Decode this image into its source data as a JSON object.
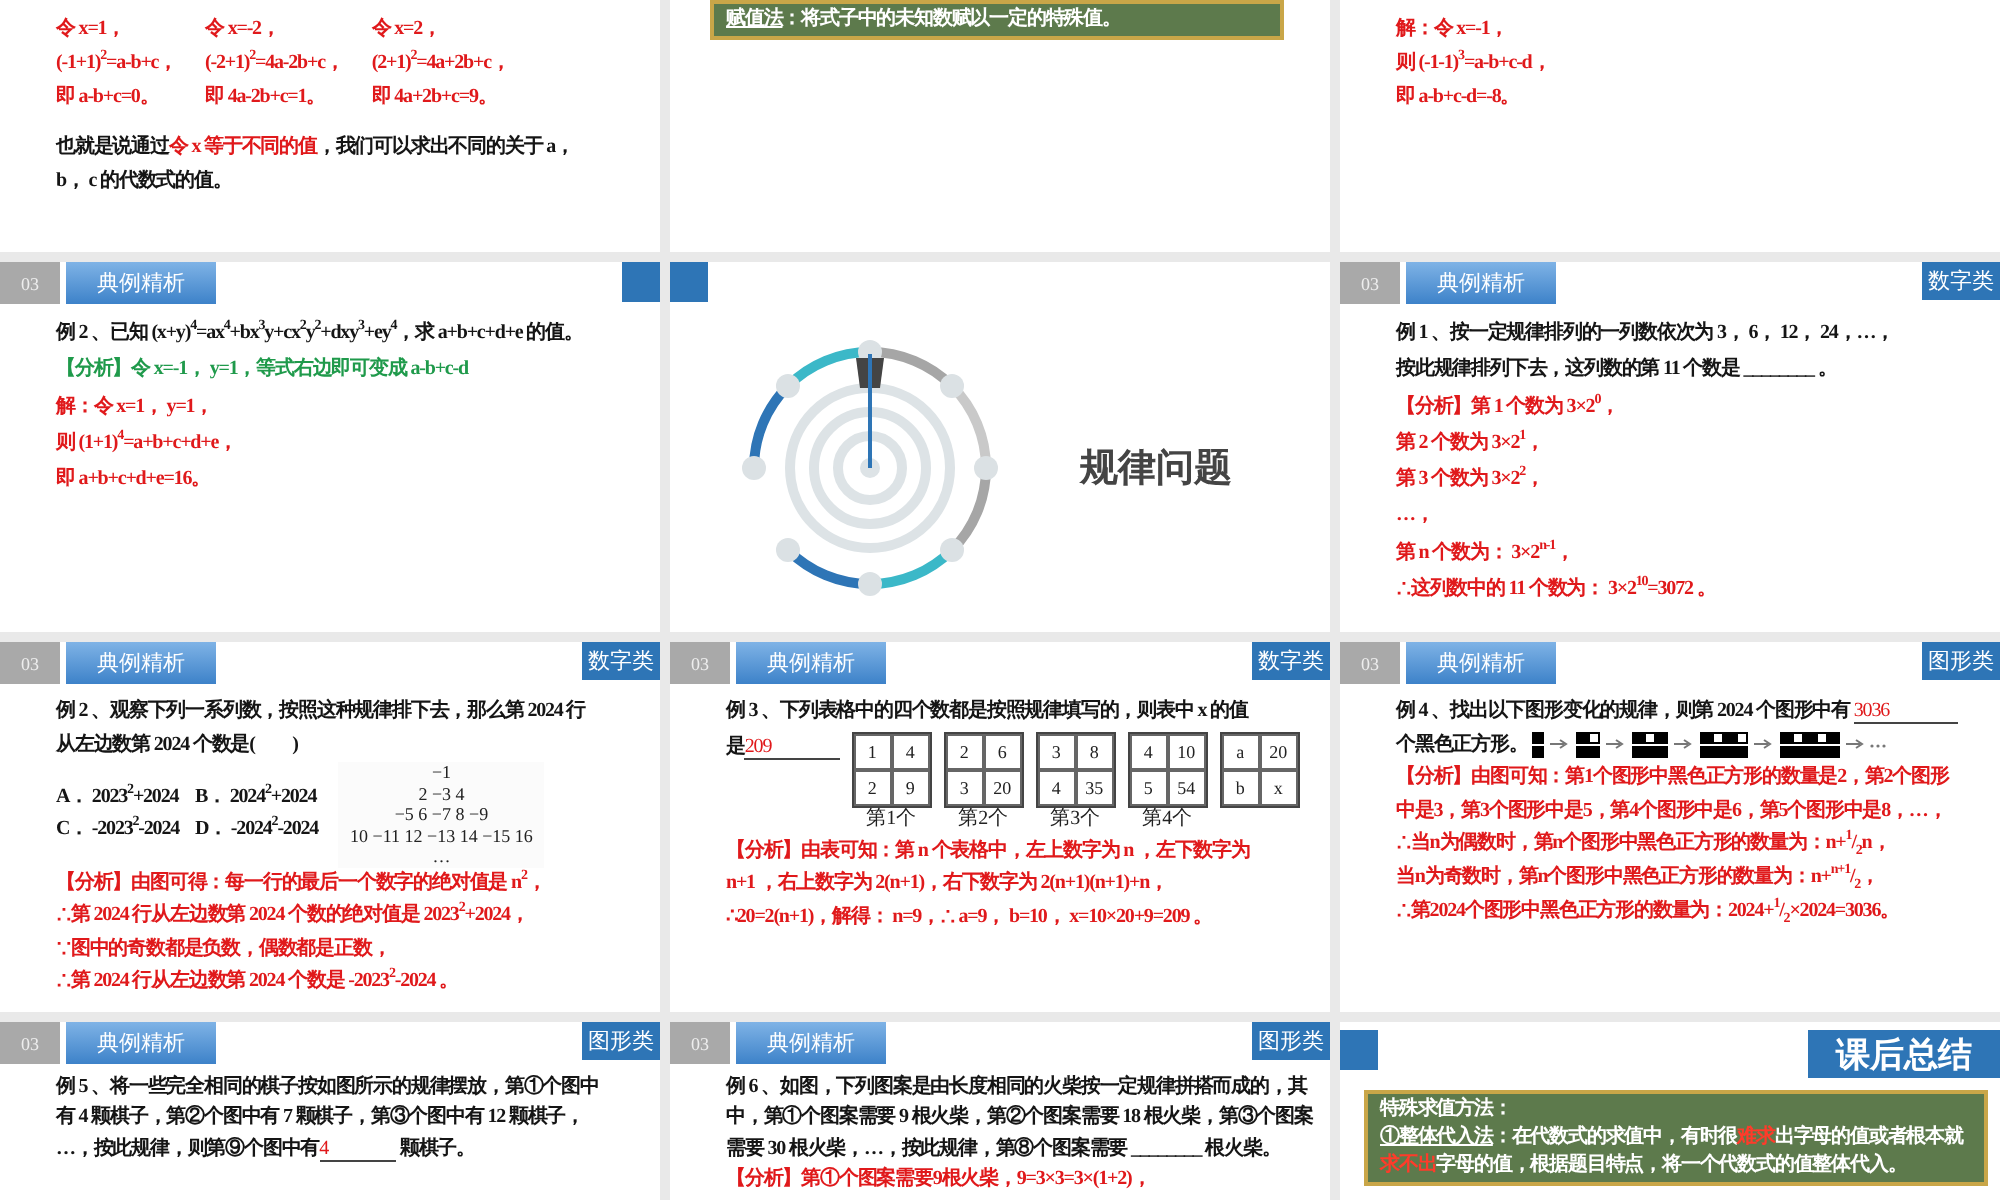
{
  "slides": [
    {
      "kind": "continuation",
      "blocks": [
        {
          "kind": "columns",
          "cells": [
            "令 x=1，",
            "令 x=-2，",
            "令 x=2，",
            "(-1+1)$^{2}$=a-b+c，",
            "(-2+1)$^{2}$=4a-2b+c，",
            "(2+1)$^{2}$=4a+2b+c，",
            "即 a-b+c=0。",
            "即 4a-2b+c=1。",
            "即 4a+2b+c=9。"
          ]
        },
        {
          "kind": "question",
          "parts": [
            {
              "kind": "question",
              "text": "也就是说通过"
            },
            {
              "kind": "answer",
              "text": "令 x 等于不同的值"
            },
            {
              "kind": "question",
              "text": "，我们可以求出不同的关于 a，"
            }
          ]
        },
        {
          "kind": "question",
          "text": "b， c 的代数式的值。"
        }
      ]
    },
    {
      "kind": "continuation",
      "blocks": [
        {
          "kind": "note",
          "lines": [
            {
              "parts": [
                {
                  "kind": "term",
                  "text": "赋值法"
                },
                {
                  "kind": "plain",
                  "text": "：将式子中的未知数赋以一定的特殊值。"
                }
              ]
            }
          ]
        }
      ]
    },
    {
      "kind": "continuation",
      "blocks": [
        {
          "kind": "answer",
          "text": "解：令 x=-1，"
        },
        {
          "kind": "answer",
          "text": "则 (-1-1)$^{3}$=a-b+c-d，"
        },
        {
          "kind": "answer",
          "text": "即 a-b+c-d=-8。"
        }
      ]
    },
    {
      "kind": "example",
      "section": "03",
      "title": "典例精析",
      "corner_square": true,
      "blocks": [
        {
          "kind": "question",
          "text": "例 2 、已知 (x+y)$^{4}$=ax$^{4}$+bx$^{3}$y+cx$^{2}$y$^{2}$+dxy$^{3}$+ey$^{4}$，求 a+b+c+d+e 的值。"
        },
        {
          "kind": "hint",
          "text": "【分析】令 x=-1， y=1，等式右边即可变成 a-b+c-d"
        },
        {
          "kind": "answer",
          "text": "解：令 x=1， y=1，"
        },
        {
          "kind": "answer",
          "text": "则 (1+1)$^{4}$=a+b+c+d+e，"
        },
        {
          "kind": "answer",
          "text": "即 a+b+c+d+e=16。"
        }
      ]
    },
    {
      "kind": "section",
      "title": "规律问题"
    },
    {
      "kind": "example",
      "section": "03",
      "title": "典例精析",
      "tag": "数字类",
      "blocks": [
        {
          "kind": "question",
          "text": "例 1 、按一定规律排列的一列数依次为 3， 6， 12， 24，…，"
        },
        {
          "kind": "question",
          "text": "按此规律排列下去，这列数的第 11 个数是 ________ 。"
        },
        {
          "kind": "answer",
          "text": "【分析】第 1 个数为 3×2$^{0}$，"
        },
        {
          "kind": "answer",
          "text": "第 2 个数为 3×2$^{1}$，"
        },
        {
          "kind": "answer",
          "text": "第 3 个数为 3×2$^{2}$，"
        },
        {
          "kind": "answer",
          "text": "…，"
        },
        {
          "kind": "answer",
          "text": "第 n 个数为： 3×2$^{n-1}$，"
        },
        {
          "kind": "answer",
          "text": "∴这列数中的 11 个数为： 3×2$^{10}$=3072 。"
        }
      ]
    },
    {
      "kind": "example",
      "section": "03",
      "title": "典例精析",
      "tag": "数字类",
      "blocks": [
        {
          "kind": "question",
          "text": "例 2 、观察下列一系列数，按照这种规律排下去，那么第 2024 行"
        },
        {
          "kind": "question",
          "text": "从左边数第 2024 个数是(　　)"
        },
        {
          "kind": "options",
          "options": [
            "A． 2023$^{2}$+2024",
            "B． 2024$^{2}$+2024",
            "C． -2023$^{2}$-2024",
            "D． -2024$^{2}$-2024"
          ],
          "triangle": [
            "−1",
            "2 −3 4",
            "−5 6 −7 8 −9",
            "10 −11 12 −13 14 −15 16",
            "…"
          ]
        },
        {
          "kind": "answer",
          "text": "【分析】由图可得：每一行的最后一个数字的绝对值是 n$^{2}$，"
        },
        {
          "kind": "answer",
          "text": "∴第 2024 行从左边数第 2024 个数的绝对值是 2023$^{2}$+2024，"
        },
        {
          "kind": "answer",
          "text": "∵图中的奇数都是负数，偶数都是正数，"
        },
        {
          "kind": "answer",
          "text": "∴第 2024 行从左边数第 2024 个数是 -2023$^{2}$-2024 。"
        }
      ]
    },
    {
      "kind": "example",
      "section": "03",
      "title": "典例精析",
      "tag": "数字类",
      "blocks": [
        {
          "kind": "question",
          "text": "例 3 、下列表格中的四个数都是按照规律填写的，则表中 x 的值"
        },
        {
          "kind": "tables",
          "parts": [
            {
              "kind": "question",
              "text": "是"
            },
            {
              "kind": "fill",
              "text": "209"
            }
          ],
          "tables": [
            {
              "cells": [
                "1",
                "4",
                "2",
                "9"
              ],
              "caption": "第1个"
            },
            {
              "cells": [
                "2",
                "6",
                "3",
                "20"
              ],
              "caption": "第2个"
            },
            {
              "cells": [
                "3",
                "8",
                "4",
                "35"
              ],
              "caption": "第3个"
            },
            {
              "cells": [
                "4",
                "10",
                "5",
                "54"
              ],
              "caption": "第4个"
            },
            {
              "cells": [
                "a",
                "20",
                "b",
                "x"
              ]
            }
          ]
        },
        {
          "kind": "answer",
          "text": "【分析】由表可知：第 n 个表格中，左上数字为 n ，左下数字为"
        },
        {
          "kind": "answer",
          "text": "n+1 ，右上数字为 2(n+1)，右下数字为 2(n+1)(n+1)+n，"
        },
        {
          "kind": "answer",
          "text": "∴20=2(n+1)，解得： n=9，∴ a=9， b=10， x=10×20+9=209 。"
        }
      ]
    },
    {
      "kind": "example",
      "section": "03",
      "title": "典例精析",
      "tag": "图形类",
      "blocks": [
        {
          "kind": "question",
          "parts": [
            {
              "kind": "question",
              "text": "例 4 、找出以下图形变化的规律，则第 2024 个图形中有 "
            },
            {
              "kind": "fill",
              "text": "3036"
            }
          ]
        },
        {
          "kind": "squares",
          "text": "个黑色正方形。"
        },
        {
          "kind": "answer",
          "text": "【分析】由图可知：第1个图形中黑色正方形的数量是2，第2个图形"
        },
        {
          "kind": "answer",
          "text": "中是3，第3个图形中是5，第4个图形中是6，第5个图形中是8，…，"
        },
        {
          "kind": "answer",
          "text": "∴当n为偶数时，第n个图形中黑色正方形的数量为：n+$^{1}$/$_{2}$n，"
        },
        {
          "kind": "answer",
          "text": "当n为奇数时，第n个图形中黑色正方形的数量为：n+$^{n+1}$/$_{2}$，"
        },
        {
          "kind": "answer",
          "text": "∴第2024个图形中黑色正方形的数量为：2024+$^{1}$/$_{2}$×2024=3036。"
        }
      ]
    },
    {
      "kind": "example",
      "section": "03",
      "title": "典例精析",
      "tag": "图形类",
      "blocks": [
        {
          "kind": "question",
          "text": "例 5 、将一些完全相同的棋子按如图所示的规律摆放，第①个图中"
        },
        {
          "kind": "question",
          "text": "有 4 颗棋子，第②个图中有 7 颗棋子，第③个图中有 12 颗棋子，"
        },
        {
          "kind": "question",
          "parts": [
            {
              "kind": "question",
              "text": "…，按此规律，则第⑨个图中有"
            },
            {
              "kind": "fill",
              "text": "4"
            },
            {
              "kind": "question",
              "text": " 颗棋子。"
            }
          ]
        }
      ]
    },
    {
      "kind": "example",
      "section": "03",
      "title": "典例精析",
      "tag": "图形类",
      "blocks": [
        {
          "kind": "question",
          "text": "例 6 、如图，下列图案是由长度相同的火柴按一定规律拼搭而成的，其"
        },
        {
          "kind": "question",
          "text": "中，第①个图案需要 9 根火柴，第②个图案需要 18 根火柴，第③个图案"
        },
        {
          "kind": "question",
          "text": "需要 30 根火柴，…，按此规律，第⑧个图案需要 ________ 根火柴。"
        },
        {
          "kind": "answer",
          "text": "【分析】第①个图案需要9根火柴，9=3×3=3×(1+2)，"
        }
      ]
    },
    {
      "kind": "summary",
      "title": "课后总结",
      "note": {
        "lines": [
          {
            "parts": [
              {
                "kind": "plain",
                "text": "特殊求值方法："
              }
            ]
          },
          {
            "parts": [
              {
                "kind": "term",
                "text": "①整体代入法"
              },
              {
                "kind": "plain",
                "text": "：在代数式的求值中，有时很"
              },
              {
                "kind": "alert",
                "text": "难求"
              },
              {
                "kind": "plain",
                "text": "出字母的值或者根本就"
              },
              {
                "kind": "alert",
                "text": "求不出"
              },
              {
                "kind": "plain",
                "text": "字母的值，根据题目特点，将一个代数式的值整体代入。"
              }
            ]
          }
        ]
      }
    }
  ]
}
